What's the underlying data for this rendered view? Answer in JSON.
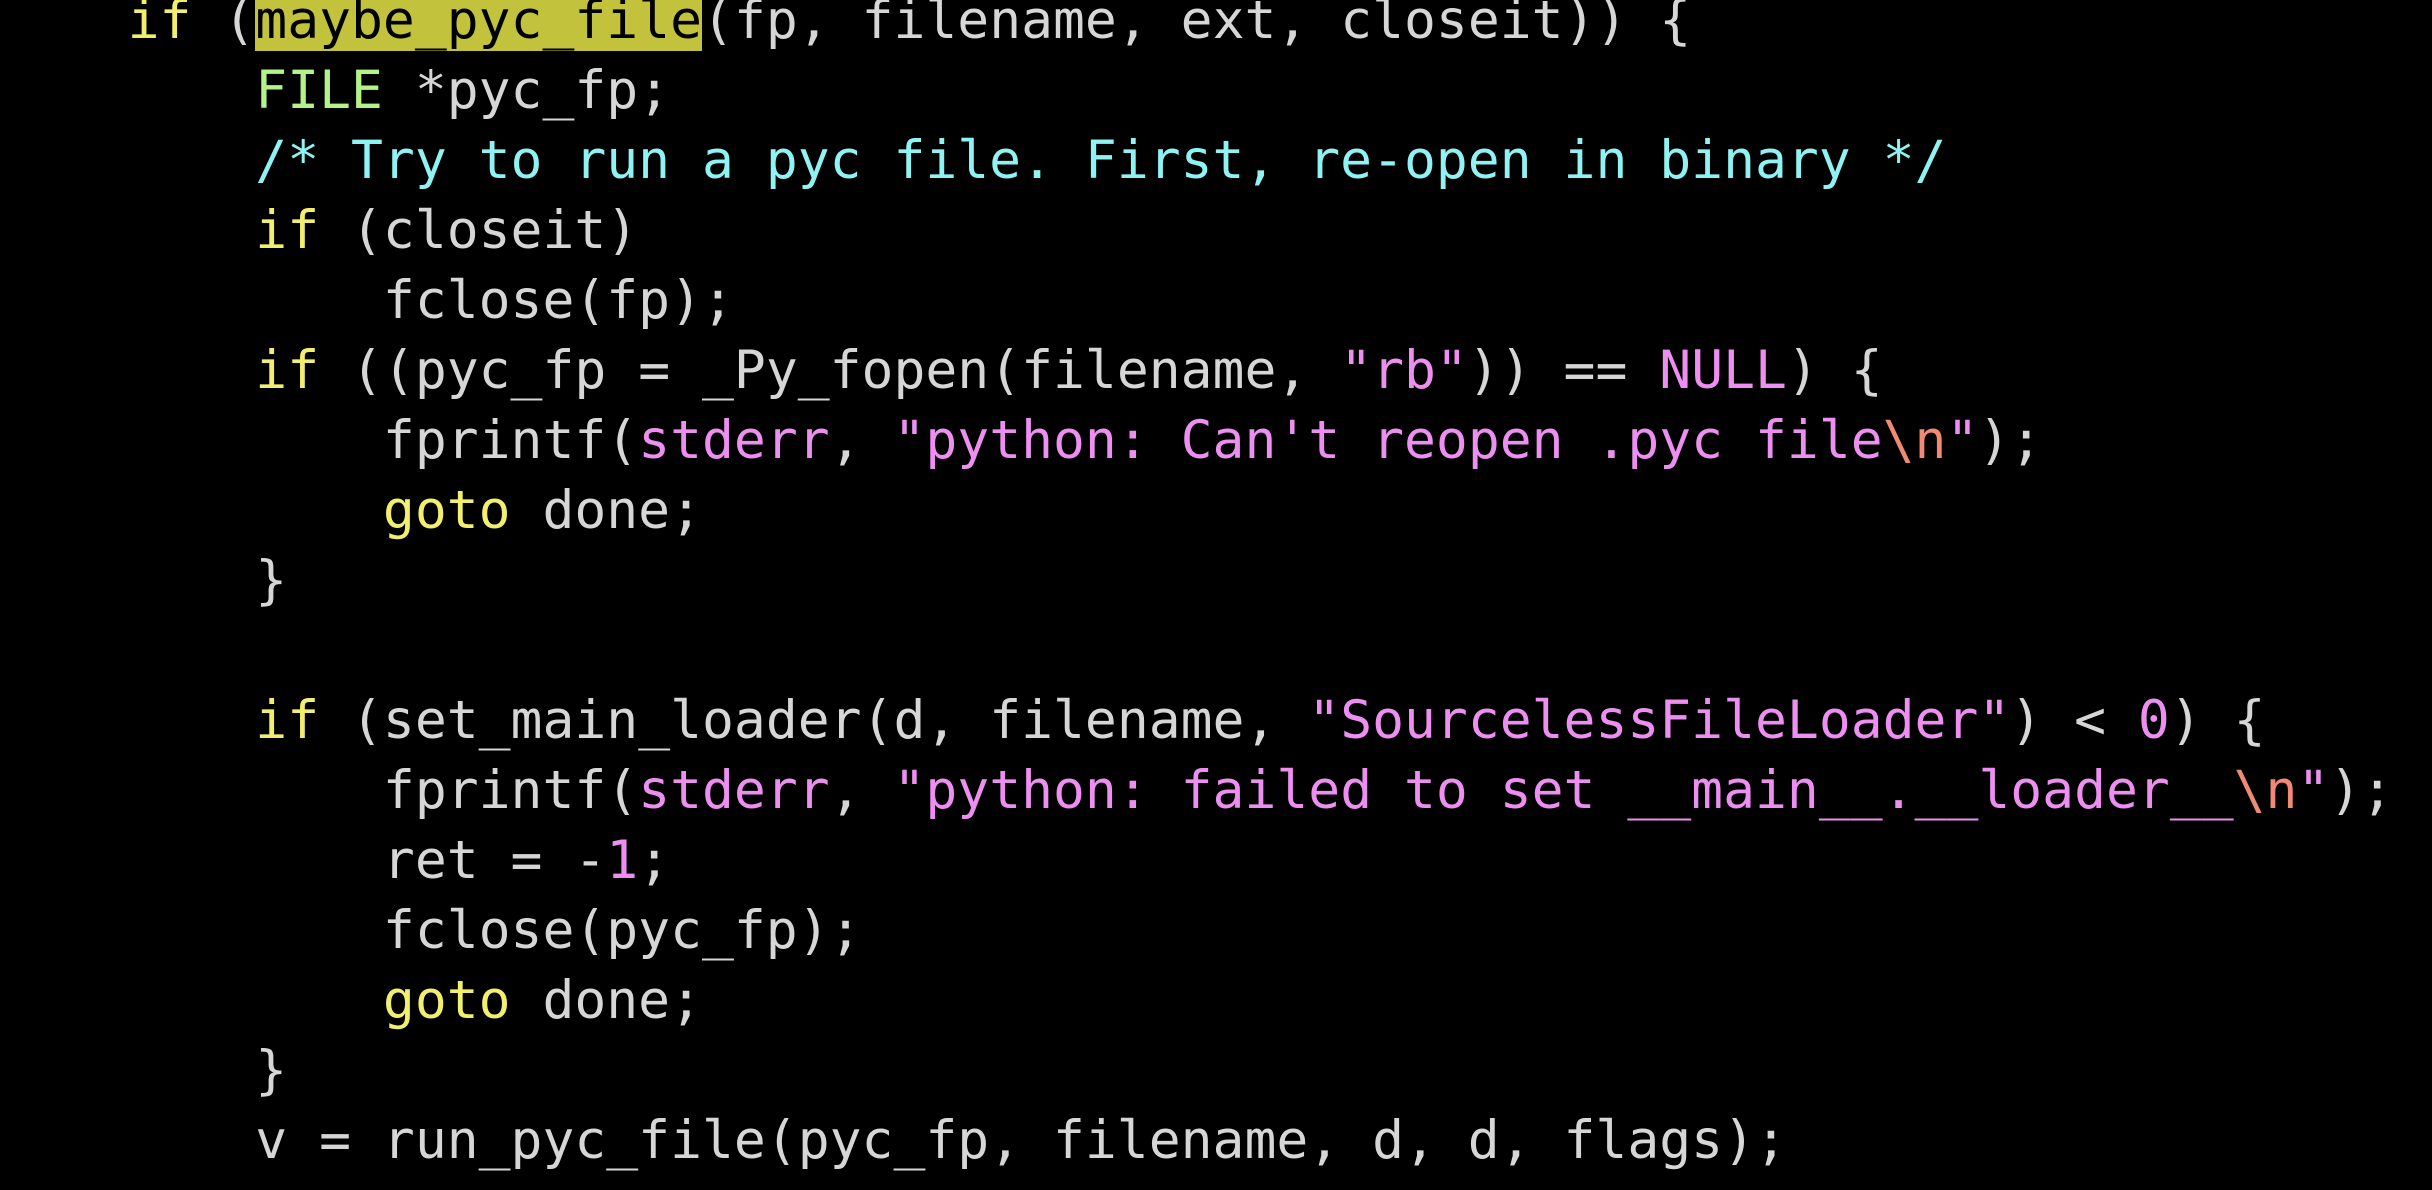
{
  "editor": {
    "colors": {
      "background": "#000000",
      "plain": "#d6d6d6",
      "keyword": "#f2ef6e",
      "type": "#b4f28a",
      "comment": "#8ff3f3",
      "string": "#ec8ff0",
      "escape": "#f08a74",
      "search_highlight": "#c2c23d"
    },
    "search_match": "maybe_pyc_file",
    "lines": [
      [
        {
          "t": "    ",
          "k": "plain"
        },
        {
          "t": "if",
          "k": "keyword"
        },
        {
          "t": " (",
          "k": "plain"
        },
        {
          "t": "maybe_pyc_file",
          "k": "search"
        },
        {
          "t": "(fp, filename, ext, closeit)) {",
          "k": "plain"
        }
      ],
      [
        {
          "t": "        ",
          "k": "plain"
        },
        {
          "t": "FILE",
          "k": "type"
        },
        {
          "t": " *pyc_fp;",
          "k": "plain"
        }
      ],
      [
        {
          "t": "        ",
          "k": "plain"
        },
        {
          "t": "/* Try to run a pyc file. First, re-open in binary */",
          "k": "comment"
        }
      ],
      [
        {
          "t": "        ",
          "k": "plain"
        },
        {
          "t": "if",
          "k": "keyword"
        },
        {
          "t": " (closeit)",
          "k": "plain"
        }
      ],
      [
        {
          "t": "            fclose(fp);",
          "k": "plain"
        }
      ],
      [
        {
          "t": "        ",
          "k": "plain"
        },
        {
          "t": "if",
          "k": "keyword"
        },
        {
          "t": " ((pyc_fp = _Py_fopen(filename, ",
          "k": "plain"
        },
        {
          "t": "\"rb\"",
          "k": "string"
        },
        {
          "t": ")) == ",
          "k": "plain"
        },
        {
          "t": "NULL",
          "k": "const"
        },
        {
          "t": ") {",
          "k": "plain"
        }
      ],
      [
        {
          "t": "            fprintf(",
          "k": "plain"
        },
        {
          "t": "stderr",
          "k": "const"
        },
        {
          "t": ", ",
          "k": "plain"
        },
        {
          "t": "\"python: Can't reopen .pyc file",
          "k": "string"
        },
        {
          "t": "\\n",
          "k": "escape"
        },
        {
          "t": "\"",
          "k": "string"
        },
        {
          "t": ");",
          "k": "plain"
        }
      ],
      [
        {
          "t": "            ",
          "k": "plain"
        },
        {
          "t": "goto",
          "k": "keyword"
        },
        {
          "t": " done;",
          "k": "plain"
        }
      ],
      [
        {
          "t": "        }",
          "k": "plain"
        }
      ],
      [
        {
          "t": "",
          "k": "plain"
        }
      ],
      [
        {
          "t": "        ",
          "k": "plain"
        },
        {
          "t": "if",
          "k": "keyword"
        },
        {
          "t": " (set_main_loader(d, filename, ",
          "k": "plain"
        },
        {
          "t": "\"SourcelessFileLoader\"",
          "k": "string"
        },
        {
          "t": ") < ",
          "k": "plain"
        },
        {
          "t": "0",
          "k": "number"
        },
        {
          "t": ") {",
          "k": "plain"
        }
      ],
      [
        {
          "t": "            fprintf(",
          "k": "plain"
        },
        {
          "t": "stderr",
          "k": "const"
        },
        {
          "t": ", ",
          "k": "plain"
        },
        {
          "t": "\"python: failed to set __main__.__loader__",
          "k": "string"
        },
        {
          "t": "\\n",
          "k": "escape"
        },
        {
          "t": "\"",
          "k": "string"
        },
        {
          "t": ");",
          "k": "plain"
        }
      ],
      [
        {
          "t": "            ret = -",
          "k": "plain"
        },
        {
          "t": "1",
          "k": "number"
        },
        {
          "t": ";",
          "k": "plain"
        }
      ],
      [
        {
          "t": "            fclose(pyc_fp);",
          "k": "plain"
        }
      ],
      [
        {
          "t": "            ",
          "k": "plain"
        },
        {
          "t": "goto",
          "k": "keyword"
        },
        {
          "t": " done;",
          "k": "plain"
        }
      ],
      [
        {
          "t": "        }",
          "k": "plain"
        }
      ],
      [
        {
          "t": "        v = run_pyc_file(pyc_fp, filename, d, d, flags);",
          "k": "plain"
        }
      ]
    ]
  }
}
